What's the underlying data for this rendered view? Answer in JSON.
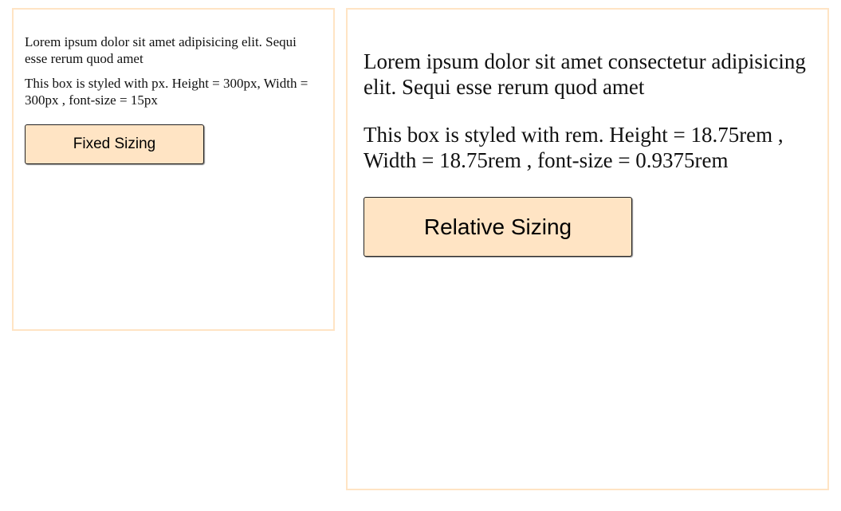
{
  "fixed_box": {
    "paragraph_1": "Lorem ipsum dolor sit amet adipisicing elit. Sequi esse rerum quod amet",
    "paragraph_2": "This box is styled with px. Height = 300px, Width = 300px , font-size = 15px",
    "button_label": "Fixed Sizing"
  },
  "relative_box": {
    "paragraph_1": "Lorem ipsum dolor sit amet consectetur adipisicing elit. Sequi esse rerum quod amet",
    "paragraph_2": "This box is styled with rem. Height = 18.75rem , Width = 18.75rem , font-size = 0.9375rem",
    "button_label": "Relative Sizing"
  },
  "colors": {
    "box_border": "#ffe4c4",
    "button_background": "#ffe4c4",
    "button_border": "#222222",
    "text": "#111111"
  }
}
